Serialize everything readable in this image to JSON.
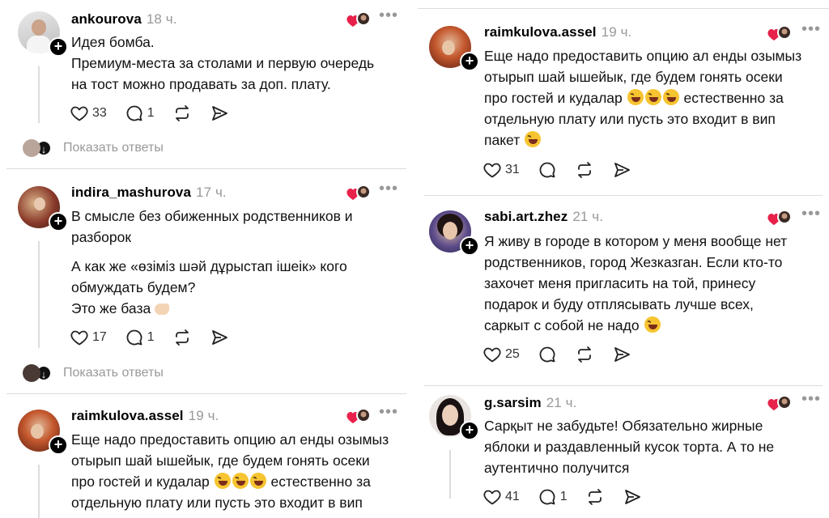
{
  "left": {
    "post1": {
      "username": "ankourova",
      "time": "18 ч.",
      "lines": [
        "Идея бомба.",
        "Премиум-места за столами и первую очередь",
        "на тост можно продавать за доп. плату."
      ],
      "likes": "33",
      "replies": "1",
      "show_replies": "Показать ответы"
    },
    "post2": {
      "username": "indira_mashurova",
      "time": "17 ч.",
      "line1": "В смысле без обиженных родственников и",
      "line2": "разборок",
      "line3": "А как же «өзіміз шәй дұрыстап ішеік» кого",
      "line4": "обмуждать будем?",
      "line5": "Это же база",
      "likes": "17",
      "replies": "1",
      "show_replies": "Показать ответы"
    },
    "post3": {
      "username": "raimkulova.assel",
      "time": "19 ч.",
      "line1": "Еще надо предоставить опцию ал енды озымыз",
      "line2": "отырып шай ышейык, где будем гонять осеки",
      "line3a": "про гостей и кудалар",
      "line3b": "естественно за",
      "line4": "отдельную плату или пусть это входит в вип"
    }
  },
  "right": {
    "post1": {
      "username": "raimkulova.assel",
      "time": "19 ч.",
      "line1": "Еще надо предоставить опцию ал енды озымыз",
      "line2": "отырып шай ышейык, где будем гонять осеки",
      "line3a": "про гостей и кудалар",
      "line3b": "естественно за",
      "line4": "отдельную плату или пусть это входит в вип",
      "line5": "пакет",
      "likes": "31"
    },
    "post2": {
      "username": "sabi.art.zhez",
      "time": "21 ч.",
      "line1": "Я живу в городе в котором у меня вообще нет",
      "line2": "родственников, город Жезказган. Если кто-то",
      "line3": "захочет меня пригласить на той, принесу",
      "line4": "подарок и буду отплясывать лучше всех,",
      "line5": "саркыт с собой не надо",
      "likes": "25"
    },
    "post3": {
      "username": "g.sarsim",
      "time": "21 ч.",
      "line1": "Сарқыт не забудьте! Обязательно жирные",
      "line2": "яблоки и раздавленный кусок торта. А то не",
      "line3": "аутентично получится",
      "likes": "41",
      "replies": "1"
    }
  },
  "colors": {
    "heart": "#e8214a",
    "muted": "#999999",
    "separator": "#dcdcdc"
  },
  "icons": [
    "heart-icon",
    "comment-icon",
    "repost-icon",
    "share-icon",
    "more-icon",
    "plus-icon",
    "arrow-down-icon",
    "laughing-emoji"
  ]
}
